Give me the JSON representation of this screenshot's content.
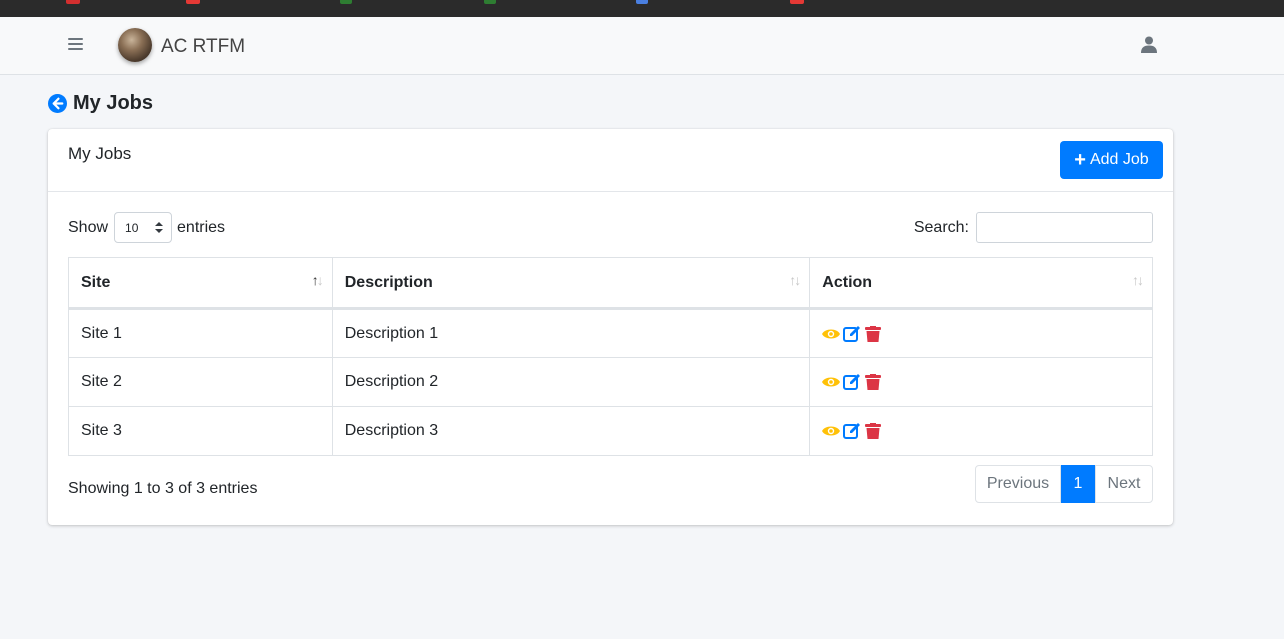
{
  "app": {
    "brand": "AC RTFM"
  },
  "page": {
    "title": "My Jobs"
  },
  "card": {
    "title": "My Jobs",
    "add_button": "Add Job"
  },
  "table_controls": {
    "show_label": "Show",
    "page_length": "10",
    "entries_label": "entries",
    "search_label": "Search:",
    "search_value": ""
  },
  "table": {
    "columns": [
      "Site",
      "Description",
      "Action"
    ],
    "rows": [
      {
        "site": "Site 1",
        "description": "Description 1"
      },
      {
        "site": "Site 2",
        "description": "Description 2"
      },
      {
        "site": "Site 3",
        "description": "Description 3"
      }
    ]
  },
  "footer": {
    "info": "Showing 1 to 3 of 3 entries",
    "previous": "Previous",
    "current_page": "1",
    "next": "Next"
  },
  "icons": {
    "menu": "hamburger-icon",
    "user": "user-icon",
    "back": "arrow-circle-left-icon",
    "view": "eye-icon",
    "edit": "edit-icon",
    "delete": "trash-icon"
  },
  "colors": {
    "primary": "#007bff",
    "view": "#ffc107",
    "edit": "#007bff",
    "delete": "#dc3545"
  }
}
